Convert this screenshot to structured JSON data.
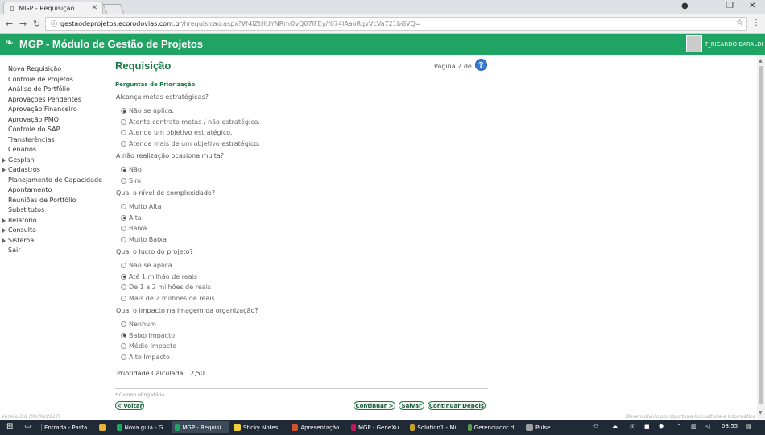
{
  "browser": {
    "tab_title": "MGP - Requisição",
    "url_host": "gestaodeprojetos.ecorodovias.com.br",
    "url_path": "/hrequisicao.aspx?W4lZtHUYNRmOvQ07IFEy/f674lAaoRgvVcVa721bGVQ="
  },
  "header": {
    "title": "MGP - Módulo de Gestão de Projetos",
    "user": "T_RICARDO BARALDI"
  },
  "sidebar": {
    "items": [
      {
        "label": "Nova Requisição",
        "sub": false
      },
      {
        "label": "Controle de Projetos",
        "sub": false
      },
      {
        "label": "Análise de Portfólio",
        "sub": false
      },
      {
        "label": "Aprovações Pendentes",
        "sub": false
      },
      {
        "label": "Aprovação Financeiro",
        "sub": false
      },
      {
        "label": "Aprovação PMO",
        "sub": false
      },
      {
        "label": "Controle do SAP",
        "sub": false
      },
      {
        "label": "Transferências",
        "sub": false
      },
      {
        "label": "Cenários",
        "sub": false
      },
      {
        "label": "Gesplan",
        "sub": true
      },
      {
        "label": "Cadastros",
        "sub": true
      },
      {
        "label": "Planejamento de Capacidade",
        "sub": false
      },
      {
        "label": "Apontamento",
        "sub": false
      },
      {
        "label": "Reuniões de Portfólio",
        "sub": false
      },
      {
        "label": "Substitutos",
        "sub": false
      },
      {
        "label": "Relatório",
        "sub": true
      },
      {
        "label": "Consulta",
        "sub": true
      },
      {
        "label": "Sistema",
        "sub": true
      },
      {
        "label": "Sair",
        "sub": false
      }
    ]
  },
  "page": {
    "title": "Requisição",
    "page_indicator": "Página 2 de 7",
    "help": "?",
    "section": "Perguntas de Priorização",
    "questions": [
      {
        "text": "Alcança metas estratégicas?",
        "options": [
          "Não se aplica.",
          "Atente contrato metas / não estratégico.",
          "Atende um objetivo estratégico.",
          "Atende mais de um objetivo estratégico."
        ],
        "selected": 0
      },
      {
        "text": "A não realização ocasiona multa?",
        "options": [
          "Não",
          "Sim"
        ],
        "selected": 0
      },
      {
        "text": "Qual o nível de complexidade?",
        "options": [
          "Muito Alta",
          "Alta",
          "Baixa",
          "Muito Baixa"
        ],
        "selected": 1
      },
      {
        "text": "Qual o lucro do projeto?",
        "options": [
          "Não se aplica",
          "Até 1 milhão de reais",
          "De 1 a 2 milhões de reais",
          "Mais de 2 milhões de reais"
        ],
        "selected": 1
      },
      {
        "text": "Qual o impacto na imagem da organização?",
        "options": [
          "Nenhum",
          "Baixo Impacto",
          "Médio Impacto",
          "Alto Impacto"
        ],
        "selected": 1
      }
    ],
    "priority_label": "Prioridade Calculada:",
    "priority_value": "2,50",
    "required_note": "* Campo obrigatório.",
    "buttons": {
      "back": "< Voltar",
      "next": "Continuar >",
      "save": "Salvar",
      "later": "Continuar Depois"
    }
  },
  "footer": {
    "version": "Versão 3.8 (09/06/2017)",
    "credit": "Desenvolvido por Oportuna Consultoria e Informática"
  },
  "taskbar": {
    "apps": [
      {
        "label": "Entrada - Pasta...",
        "color": "#2b7cd3"
      },
      {
        "label": "",
        "color": "#e8b53a"
      },
      {
        "label": "Nova guia - G...",
        "color": "#1fa463"
      },
      {
        "label": "MGP - Requisi...",
        "color": "#1fa463"
      },
      {
        "label": "Sticky Notes",
        "color": "#f4d03f"
      },
      {
        "label": "Apresentação...",
        "color": "#d35230"
      },
      {
        "label": "MGP - GeneXu...",
        "color": "#c2185b"
      },
      {
        "label": "Solution1 - Mi...",
        "color": "#c9a227"
      },
      {
        "label": "Gerenciador d...",
        "color": "#5b9b4b"
      },
      {
        "label": "Pulse",
        "color": "#9e9e9e"
      }
    ],
    "clock": "08:55"
  }
}
